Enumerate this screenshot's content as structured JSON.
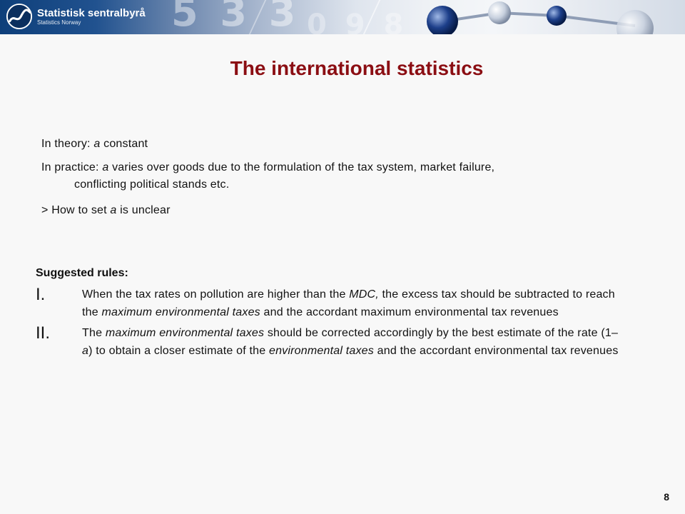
{
  "header": {
    "logo_name": "Statistisk sentralbyrå",
    "logo_sub": "Statistics Norway",
    "icon": "ssb-logo-icon",
    "colors": {
      "title": "#8b0e13",
      "banner": "#21528f"
    }
  },
  "slide": {
    "title": "The international statistics",
    "p1": {
      "a": "In theory: ",
      "b": "a",
      "c": " constant"
    },
    "p2": {
      "a": "In practice: ",
      "b": "a",
      "c": " varies over goods due to the formulation of the tax system, market failure,",
      "d": "conflicting political stands etc."
    },
    "p3": {
      "a": "> How to set ",
      "b": "a",
      "c": " is unclear"
    },
    "rules_heading": "Suggested rules:",
    "rule1": {
      "num": "I.",
      "t1": "When the tax rates on pollution are higher than the ",
      "t2": "MDC,",
      "t3": " the excess tax should be subtracted to reach the ",
      "t4": "maximum environmental taxes",
      "t5": " and the accordant maximum environmental tax revenues"
    },
    "rule2": {
      "num": "II.",
      "t1": "The ",
      "t2": "maximum environmental taxes",
      "t3": " should be corrected accordingly by the best estimate of the rate (1–",
      "t4": "a",
      "t5": ") to obtain a closer estimate of the ",
      "t6": "environmental taxes",
      "t7": " and the accordant environmental tax revenues"
    },
    "page_number": "8"
  }
}
